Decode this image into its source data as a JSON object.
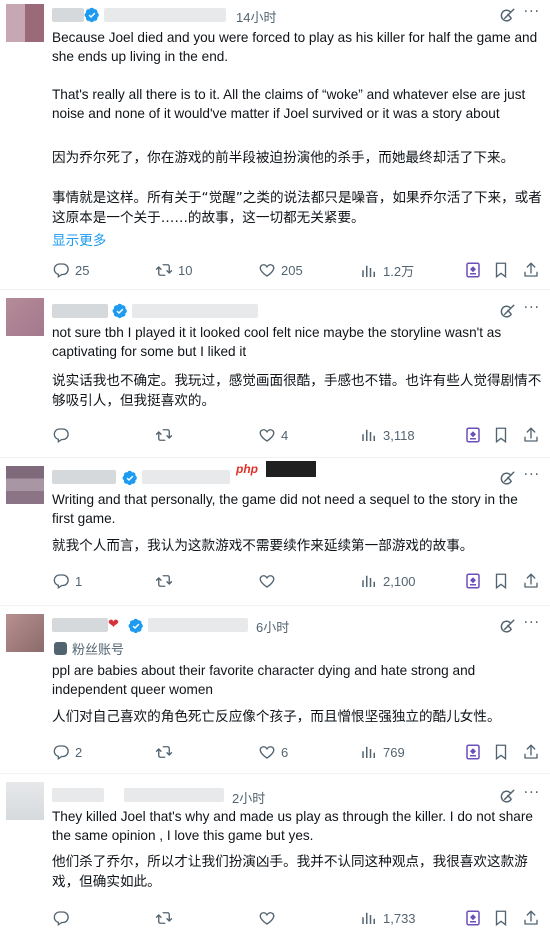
{
  "tweets": [
    {
      "time": "14小时",
      "text_en": "Because Joel died and you were forced to play as his killer for half the game and she ends up living in the end.\n\nThat's really all there is to it. All the claims of “woke” and whatever else are just noise and none of it would've matter if Joel survived or it was a story about",
      "text_zh": "因为乔尔死了，你在游戏的前半段被迫扮演他的杀手，而她最终却活了下来。\n\n事情就是这样。所有关于“觉醒”之类的说法都只是噪音，如果乔尔活了下来，或者这原本是一个关于……的故事，这一切都无关紧要。",
      "show_more": "显示更多",
      "replies": "25",
      "retweets": "10",
      "likes": "205",
      "views": "1.2万"
    },
    {
      "time": "",
      "text_en": "not sure tbh I played it it looked cool felt nice maybe the storyline wasn't as captivating for some but I liked it",
      "text_zh": "说实话我也不确定。我玩过，感觉画面很酷，手感也不错。也许有些人觉得剧情不够吸引人，但我挺喜欢的。",
      "replies": "",
      "retweets": "",
      "likes": "4",
      "views": "3,118"
    },
    {
      "time": "",
      "text_en": "Writing and that personally, the game did not need a sequel to the story in the first game.",
      "text_zh": "就我个人而言，我认为这款游戏不需要续作来延续第一部游戏的故事。",
      "replies": "1",
      "retweets": "",
      "likes": "",
      "views": "2,100",
      "watermark": "php"
    },
    {
      "time": "6小时",
      "fans_label": "粉丝账号",
      "text_en": "ppl are babies about their favorite character dying and hate strong and independent queer women",
      "text_zh": "人们对自己喜欢的角色死亡反应像个孩子，而且憎恨坚强独立的酷儿女性。",
      "replies": "2",
      "retweets": "",
      "likes": "6",
      "views": "769"
    },
    {
      "time": "2小时",
      "text_en": "They killed Joel that's why and made us play as through the killer. I do not share the same opinion , I love this game but yes.",
      "text_zh": "他们杀了乔尔，所以才让我们扮演凶手。我并不认同这种观点，我很喜欢这款游戏，但确实如此。",
      "replies": "",
      "retweets": "",
      "likes": "",
      "views": "1,733"
    }
  ],
  "colors": {
    "text": "#0f1419",
    "muted": "#536471",
    "link": "#1d9bf0",
    "verified": "#1d9bf0",
    "boost": "#6b4fbb"
  }
}
